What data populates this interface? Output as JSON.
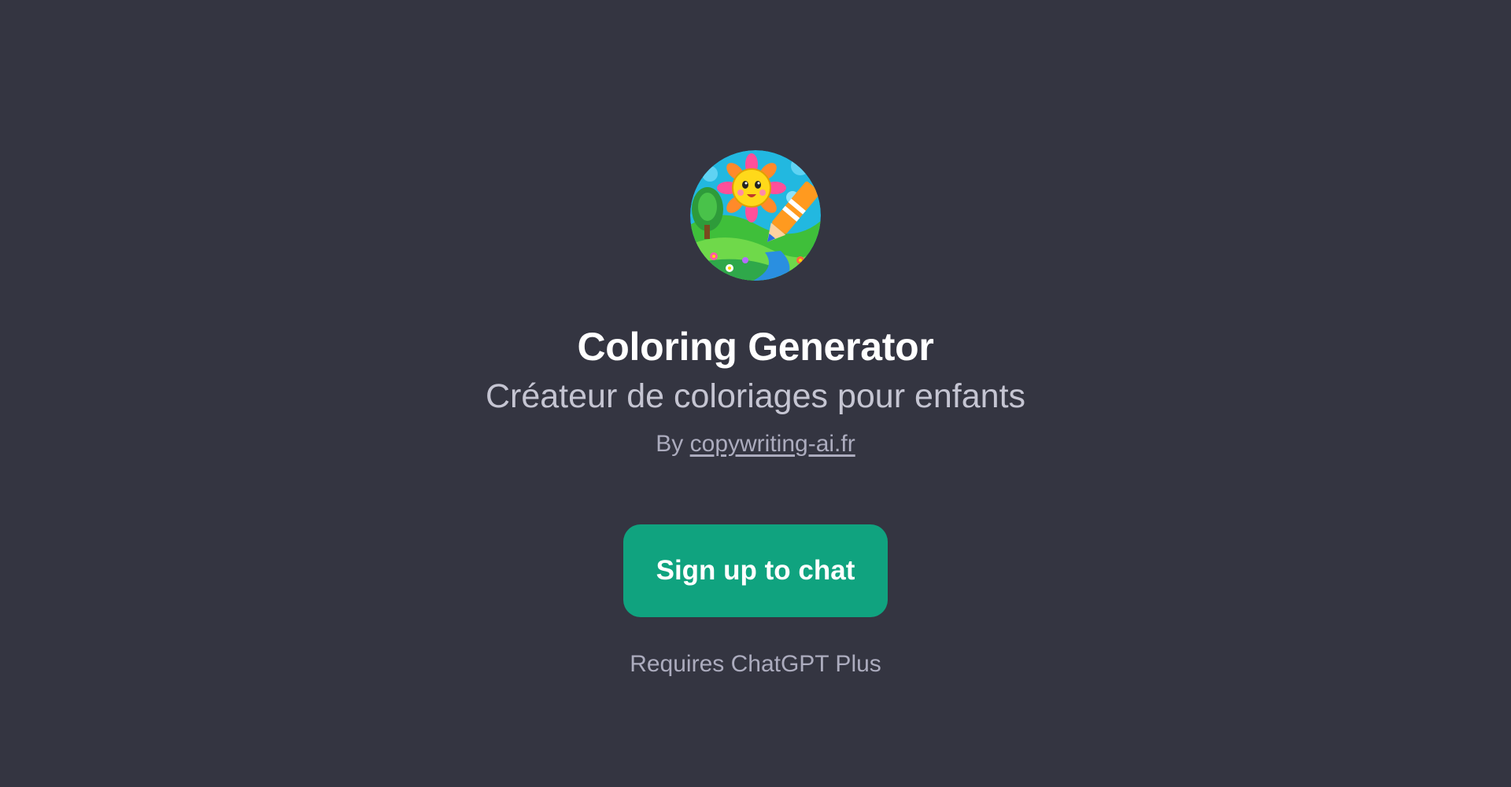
{
  "gpt": {
    "name": "Coloring Generator",
    "description": "Créateur de coloriages pour enfants",
    "by_prefix": "By",
    "author": "copywriting-ai.fr",
    "avatar_icon": "sun-flower-crayon-illustration"
  },
  "cta": {
    "label": "Sign up to chat"
  },
  "footer": {
    "note": "Requires ChatGPT Plus"
  },
  "colors": {
    "background": "#343541",
    "button": "#10a37f",
    "title": "#ffffff",
    "subtitle": "#c5c5d2",
    "muted": "#acacbe"
  }
}
